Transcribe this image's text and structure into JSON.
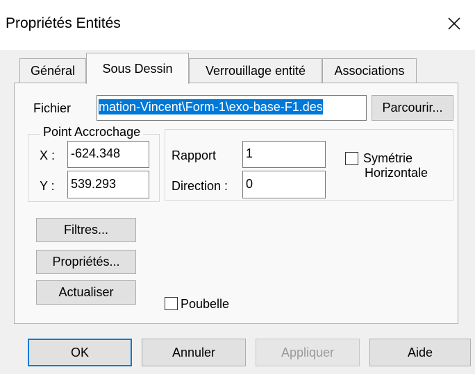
{
  "window": {
    "title": "Propriétés Entités",
    "close_icon": "close-icon"
  },
  "tabs": [
    {
      "label": "Général"
    },
    {
      "label": "Sous Dessin",
      "active": true
    },
    {
      "label": "Verrouillage entité"
    },
    {
      "label": "Associations"
    }
  ],
  "file": {
    "label": "Fichier",
    "value": "mation-Vincent\\Form-1\\exo-base-F1.des",
    "browse_label": "Parcourir..."
  },
  "anchor": {
    "legend": "Point Accrochage",
    "x_label": "X :",
    "x_value": "-624.348",
    "y_label": "Y :",
    "y_value": "539.293"
  },
  "transform": {
    "ratio_label": "Rapport",
    "ratio_value": "1",
    "direction_label": "Direction :",
    "direction_value": "0",
    "symmetry_line1": "Symétrie",
    "symmetry_line2": "Horizontale"
  },
  "actions": {
    "filters_label": "Filtres...",
    "properties_label": "Propriétés...",
    "refresh_label": "Actualiser"
  },
  "trash": {
    "label": "Poubelle"
  },
  "footer": {
    "ok_label": "OK",
    "cancel_label": "Annuler",
    "apply_label": "Appliquer",
    "help_label": "Aide"
  },
  "colors": {
    "accent": "#0078d7",
    "selection_bg": "#0078d7",
    "selection_text": "#ffffff"
  }
}
